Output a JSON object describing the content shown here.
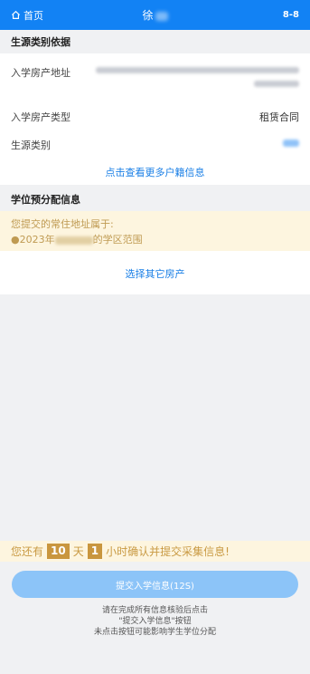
{
  "header": {
    "home_label": "首页",
    "title": "徐",
    "right_text": "8-8"
  },
  "section1": {
    "title": "生源类别依据",
    "rows": [
      {
        "label": "入学房产地址"
      },
      {
        "label": "入学房产类型",
        "value": "租赁合同"
      },
      {
        "label": "生源类别"
      }
    ],
    "more_link": "点击查看更多户籍信息"
  },
  "section2": {
    "title": "学位预分配信息",
    "notice_line1": "您提交的常住地址属于:",
    "notice_prefix": "●2023年",
    "notice_suffix": "的学区范围",
    "choose_link": "选择其它房产"
  },
  "countdown": {
    "prefix": "您还有",
    "days": "10",
    "day_unit": "天",
    "hours": "1",
    "suffix": "小时确认并提交采集信息!"
  },
  "submit_label": "提交入学信息(12S)",
  "footnote": [
    "请在完成所有信息核验后点击",
    "\"提交入学信息\"按钮",
    "未点击按钮可能影响学生学位分配"
  ],
  "colors": {
    "header": "#1282f4",
    "link": "#1a7fe6",
    "notice_bg": "#fdf5df",
    "submit": "#8cc4f8"
  }
}
